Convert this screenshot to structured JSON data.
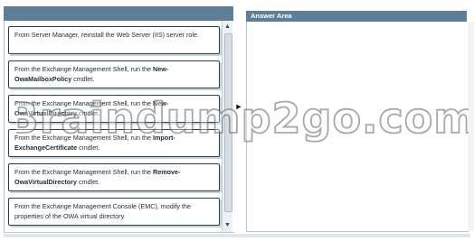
{
  "answer_area": {
    "title": "Answer Area"
  },
  "items": [
    {
      "parts": [
        {
          "text": "From Server Manager, reinstall the Web Server (IIS) server role.",
          "bold": false
        }
      ]
    },
    {
      "parts": [
        {
          "text": "From the Exchange Management Shell, run the ",
          "bold": false
        },
        {
          "text": "New-OwaMailboxPolicy",
          "bold": true
        },
        {
          "text": " cmdlet.",
          "bold": false
        }
      ]
    },
    {
      "parts": [
        {
          "text": "From the Exchange Management Shell, run the ",
          "bold": false
        },
        {
          "text": "New-OwaVirtualDirectory",
          "bold": true
        },
        {
          "text": " cmdlet.",
          "bold": false
        }
      ]
    },
    {
      "parts": [
        {
          "text": "From the Exchange Management Shell, run the ",
          "bold": false
        },
        {
          "text": "Import-ExchangeCertificate",
          "bold": true
        },
        {
          "text": " cmdlet.",
          "bold": false
        }
      ]
    },
    {
      "parts": [
        {
          "text": "From the Exchange Management Shell, run the ",
          "bold": false
        },
        {
          "text": "Remove-OwaVirtualDirectory",
          "bold": true
        },
        {
          "text": " cmdlet.",
          "bold": false
        }
      ]
    },
    {
      "parts": [
        {
          "text": "From the Exchange Management Console (EMC), modify the properties of the OWA virtual directory.",
          "bold": false
        }
      ]
    }
  ],
  "scrollbar": {
    "up_glyph": "▲",
    "down_glyph": "▼"
  },
  "move_arrow": {
    "glyph": "►"
  },
  "watermark": {
    "text": "Braindump2go.com"
  },
  "colors": {
    "header": "#5e7e98",
    "item_border": "#2f3f4e"
  }
}
